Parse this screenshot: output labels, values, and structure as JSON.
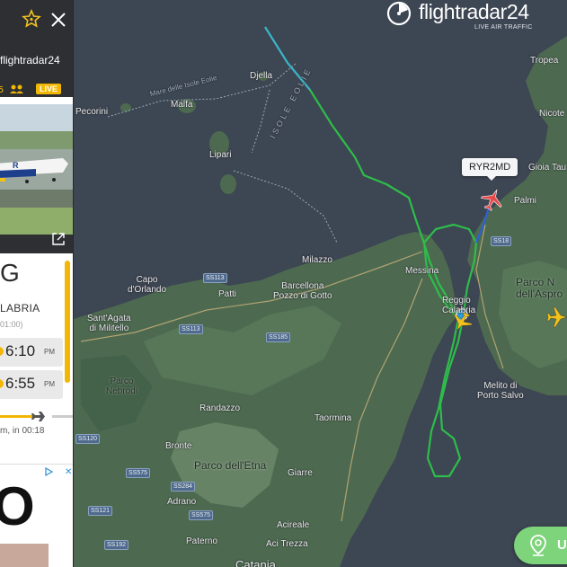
{
  "logo": {
    "wordmark": "flightradar24",
    "tagline": "LIVE AIR TRAFFIC"
  },
  "flight": {
    "callsign": "RYR2MD"
  },
  "panel": {
    "brand": "flightradar24",
    "live_label": "LIVE",
    "destination": {
      "code": "G",
      "name": "LABRIA",
      "tz": "01:00)"
    },
    "times": [
      {
        "time": "6:10",
        "ampm": "PM"
      },
      {
        "time": "6:55",
        "ampm": "PM"
      }
    ],
    "progress_text": "m, in 00:18",
    "ad": {
      "text": "O"
    }
  },
  "bottom_button": {
    "label": "U"
  },
  "labels": {
    "stromboli_sea": "Mare delle Isole Eolie",
    "isole_eolie": "ISOLE EOLIE",
    "isole_eolie2": "ISOLE EOLIE",
    "dejalla": "Djella",
    "malfa": "Malfa",
    "pecorini": "Pecorini",
    "lipari": "Lipari",
    "milazzo": "Milazzo",
    "barcellona": "Barcellona\nPozzo di Gotto",
    "messina": "Messina",
    "reggio": "Reggio\nCalabria",
    "capo": "Capo\nd'Orlando",
    "patti": "Patti",
    "sant_agata": "Sant'Agata\ndi Militello",
    "parco_nebrodi": "Parco\nNebrodi",
    "randazzo": "Randazzo",
    "taormina": "Taormina",
    "bronte": "Bronte",
    "parco_etna": "Parco dell'Etna",
    "giarre": "Giarre",
    "adrano": "Adrano",
    "acireale": "Acireale",
    "paterno": "Paterno",
    "aci_trezza": "Aci Trezza",
    "catania": "Catania",
    "melito": "Melito di\nPorto Salvo",
    "palmi": "Palmi",
    "gioia": "Gioia Tau",
    "tropea": "Tropea",
    "nicotera": "Nicote",
    "parco_aspro": "Parco N\ndell'Aspro",
    "ss113": "SS113",
    "ss113b": "SS113",
    "ss185": "SS185",
    "ss120": "SS120",
    "ss575": "SS575",
    "ss284": "SS284",
    "ss121": "SS121",
    "ss192": "SS192",
    "ss18": "SS18",
    "ss575b": "SS575"
  },
  "colors": {
    "sea": "#3d4653",
    "land": "#4a6b4f",
    "track_green": "#2ebd4a",
    "track_blue": "#2d5fd8",
    "track_cyan": "#3ab5c8",
    "plane_red": "#e84a4a",
    "plane_yellow": "#f2c21a",
    "badge_yellow": "#f2b705"
  },
  "icons": [
    "star-icon",
    "close-icon",
    "group-icon",
    "expand-icon",
    "plane-icon",
    "location-pin-icon",
    "ad-choices-icon"
  ]
}
